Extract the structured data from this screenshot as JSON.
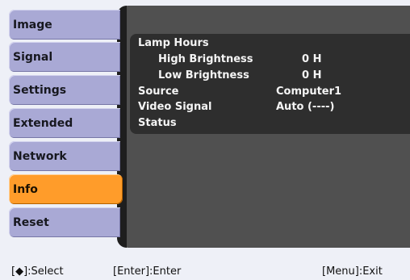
{
  "menu": {
    "items": [
      {
        "label": "Image"
      },
      {
        "label": "Signal"
      },
      {
        "label": "Settings"
      },
      {
        "label": "Extended"
      },
      {
        "label": "Network"
      },
      {
        "label": "Info"
      },
      {
        "label": "Reset"
      }
    ],
    "active_index": 5
  },
  "info": {
    "lamp_hours_label": "Lamp Hours",
    "high_brightness_label": "High Brightness",
    "high_brightness_value": "0  H",
    "low_brightness_label": "Low Brightness",
    "low_brightness_value": "0  H",
    "source_label": "Source",
    "source_value": "Computer1",
    "video_signal_label": "Video Signal",
    "video_signal_value": "Auto (----)",
    "status_label": "Status"
  },
  "bottom_bar": {
    "select_hint": "[◆]:Select",
    "enter_hint": "[Enter]:Enter",
    "exit_hint": "[Menu]:Exit"
  },
  "colors": {
    "menu_item": "#a9a9d5",
    "menu_active": "#ff9c2a",
    "panel": "#505050",
    "panel_inner": "#2e2e2e",
    "background": "#eef0f7"
  }
}
